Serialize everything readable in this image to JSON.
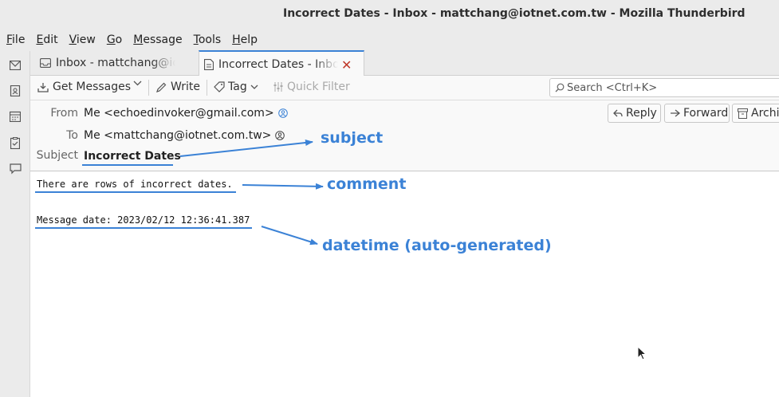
{
  "window": {
    "title": "Incorrect Dates - Inbox - mattchang@iotnet.com.tw - Mozilla Thunderbird"
  },
  "menu": [
    {
      "first": "F",
      "rest": "ile"
    },
    {
      "first": "E",
      "rest": "dit"
    },
    {
      "first": "V",
      "rest": "iew"
    },
    {
      "first": "G",
      "rest": "o"
    },
    {
      "first": "M",
      "rest": "essage"
    },
    {
      "first": "T",
      "rest": "ools"
    },
    {
      "first": "H",
      "rest": "elp"
    }
  ],
  "tabs": [
    {
      "label": "Inbox - mattchang@iotnet.com.tw",
      "icon": "inbox-icon"
    },
    {
      "label": "Incorrect Dates - Inbox",
      "icon": "message-icon"
    }
  ],
  "toolbar": {
    "get_messages": "Get Messages",
    "write": "Write",
    "tag": "Tag",
    "quick_filter": "Quick Filter",
    "search_placeholder": "Search <Ctrl+K>"
  },
  "header": {
    "from_label": "From",
    "from_value": "Me <echoedinvoker@gmail.com>",
    "to_label": "To",
    "to_value": "Me <mattchang@iotnet.com.tw>",
    "subject_label": "Subject",
    "subject_value": "Incorrect Dates",
    "buttons": {
      "reply": "Reply",
      "forward": "Forward",
      "archive": "Archive"
    }
  },
  "body": {
    "comment": "There are rows of incorrect dates.",
    "message_date": "Message date: 2023/02/12 12:36:41.387"
  },
  "annotations": {
    "subject": "subject",
    "comment": "comment",
    "datetime": "datetime (auto-generated)"
  },
  "colors": {
    "annotation": "#3b82d6",
    "accent": "#3b82d6"
  }
}
